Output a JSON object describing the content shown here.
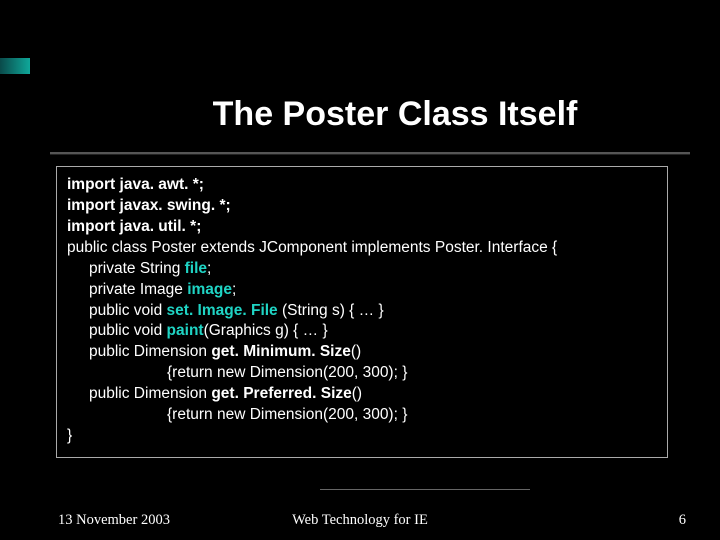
{
  "title": "The Poster Class Itself",
  "code": {
    "l1": "import java. awt. *;",
    "l2": "import javax. swing. *;",
    "l3": "import java. util. *;",
    "l4": "public class Poster extends JComponent implements Poster. Interface {",
    "l5a": "private String ",
    "l5b": "file",
    "l5c": ";",
    "l6a": "private Image ",
    "l6b": "image",
    "l6c": ";",
    "l7a": "public void ",
    "l7b": "set. Image. File",
    "l7c": " (String s) { … }",
    "l8a": "public void ",
    "l8b": "paint",
    "l8c": "(Graphics g) { … }",
    "l9a": "public Dimension ",
    "l9b": "get. Minimum. Size",
    "l9c": "()",
    "l10": "{return new Dimension(200, 300); }",
    "l11a": "public Dimension ",
    "l11b": "get. Preferred. Size",
    "l11c": "()",
    "l12": "{return new Dimension(200, 300); }",
    "l13": "}"
  },
  "footer": {
    "date": "13 November 2003",
    "center": "Web Technology for IE",
    "page": "6"
  }
}
